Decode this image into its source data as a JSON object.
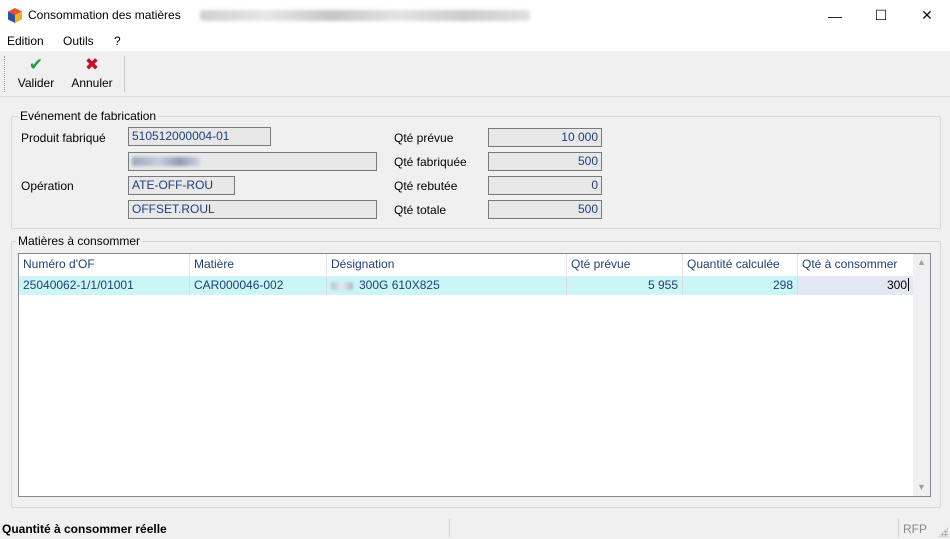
{
  "window": {
    "title": "Consommation des matières",
    "controls": {
      "minimize": "—",
      "maximize": "☐",
      "close": "✕"
    }
  },
  "menu": {
    "items": [
      "Edition",
      "Outils",
      "?"
    ]
  },
  "toolbar": {
    "validate": {
      "label": "Valider",
      "icon": "check-icon",
      "color": "#1e9e3a"
    },
    "cancel": {
      "label": "Annuler",
      "icon": "cross-icon",
      "color": "#c8102e"
    }
  },
  "event": {
    "title": "Evénement de fabrication",
    "product_label": "Produit fabriqué",
    "product_code": "510512000004-01",
    "operation_label": "Opération",
    "operation_code": "ATE-OFF-ROU",
    "operation_name": "OFFSET.ROUL",
    "qty_planned_label": "Qté prévue",
    "qty_planned": "10 000",
    "qty_produced_label": "Qté fabriquée",
    "qty_produced": "500",
    "qty_scrapped_label": "Qté rebutée",
    "qty_scrapped": "0",
    "qty_total_label": "Qté totale",
    "qty_total": "500"
  },
  "materials": {
    "title": "Matières à consommer",
    "columns": [
      "Numéro d'OF",
      "Matière",
      "Désignation",
      "Qté prévue",
      "Quantité calculée",
      "Qté à consommer"
    ],
    "rows": [
      {
        "of_number": "25040062-1/1/01001",
        "material": "CAR000046-002",
        "designation": "300G 610X825",
        "qty_planned": "5 955",
        "qty_calculated": "298",
        "qty_to_consume": "300"
      }
    ]
  },
  "status": {
    "message": "Quantité à consommer réelle",
    "right": "RFP"
  }
}
